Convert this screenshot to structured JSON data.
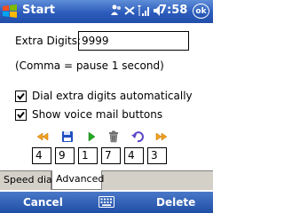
{
  "titlebar": {
    "title": "Start",
    "clock": "7:58",
    "ok_label": "ok",
    "icons": [
      "windows-flag-icon",
      "people-icon",
      "connectivity-icon",
      "signal-icon",
      "speaker-icon"
    ]
  },
  "form": {
    "extra_digits_label": "Extra Digits:",
    "extra_digits_value": "9999",
    "hint": "(Comma = pause 1 second)",
    "checkbox_dial_label": "Dial extra digits automatically",
    "checkbox_dial_checked": true,
    "checkbox_voicemail_label": "Show voice mail buttons",
    "checkbox_voicemail_checked": true
  },
  "toolbar": {
    "icons": [
      "rewind-icon",
      "save-icon",
      "play-icon",
      "trash-icon",
      "undo-icon",
      "fast-forward-icon"
    ],
    "colors": {
      "orange": "#f0a020",
      "blue": "#2050c0",
      "green": "#22aa22",
      "gray": "#707070",
      "purple": "#5a48c8"
    }
  },
  "digits": [
    "4",
    "9",
    "1",
    "7",
    "4",
    "3"
  ],
  "tabs": [
    {
      "label": "Speed dial",
      "active": false
    },
    {
      "label": "Advanced",
      "active": true
    }
  ],
  "softkeys": {
    "left": "Cancel",
    "right": "Delete"
  }
}
